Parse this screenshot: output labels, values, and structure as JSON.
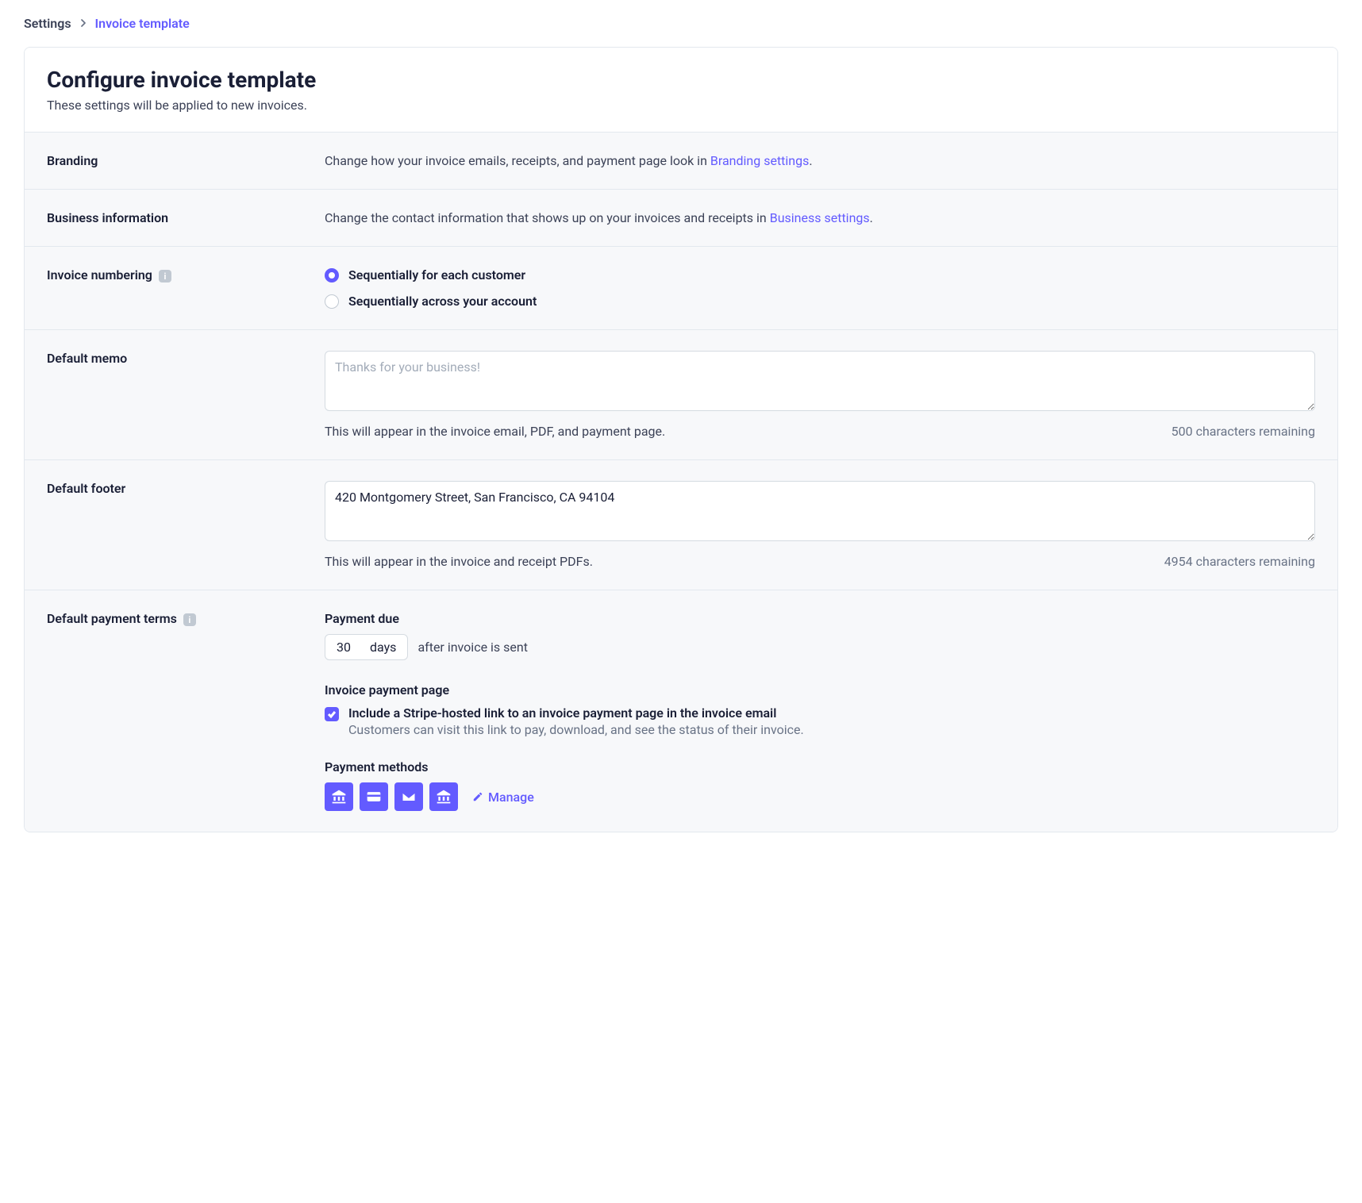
{
  "breadcrumb": {
    "parent": "Settings",
    "current": "Invoice template"
  },
  "header": {
    "title": "Configure invoice template",
    "subtitle": "These settings will be applied to new invoices."
  },
  "branding": {
    "label": "Branding",
    "description_prefix": "Change how your invoice emails, receipts, and payment page look in ",
    "link_text": "Branding settings",
    "description_suffix": "."
  },
  "business": {
    "label": "Business information",
    "description_prefix": "Change the contact information that shows up on your invoices and receipts in ",
    "link_text": "Business settings",
    "description_suffix": "."
  },
  "numbering": {
    "label": "Invoice numbering",
    "option1": "Sequentially for each customer",
    "option2": "Sequentially across your account"
  },
  "memo": {
    "label": "Default memo",
    "placeholder": "Thanks for your business!",
    "value": "",
    "helper": "This will appear in the invoice email, PDF, and payment page.",
    "remaining": "500 characters remaining"
  },
  "footer": {
    "label": "Default footer",
    "value": "420 Montgomery Street, San Francisco, CA 94104",
    "helper": "This will appear in the invoice and receipt PDFs.",
    "remaining": "4954 characters remaining"
  },
  "payment_terms": {
    "label": "Default payment terms",
    "payment_due_label": "Payment due",
    "days_value": "30",
    "days_unit": "days",
    "after_text": "after invoice is sent",
    "payment_page_label": "Invoice payment page",
    "checkbox_label": "Include a Stripe-hosted link to an invoice payment page in the invoice email",
    "checkbox_desc": "Customers can visit this link to pay, download, and see the status of their invoice.",
    "payment_methods_label": "Payment methods",
    "manage_label": "Manage"
  }
}
